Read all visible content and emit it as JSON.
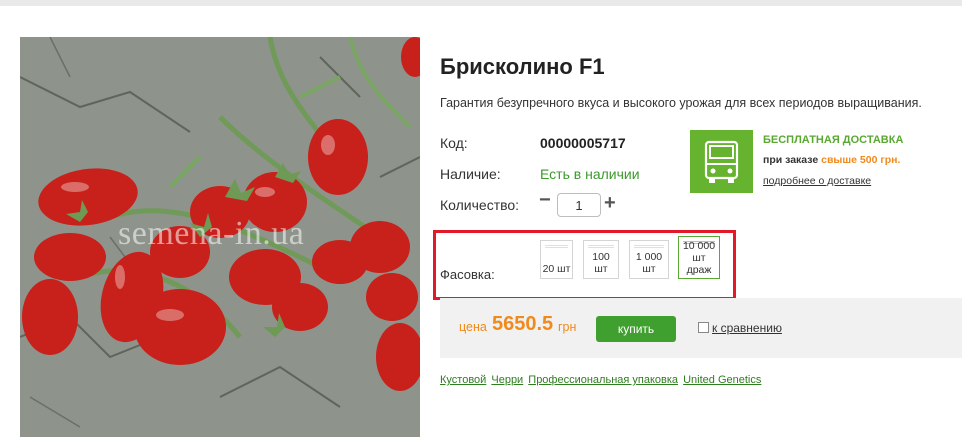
{
  "product": {
    "photo_alt": "Брисколино F1",
    "watermark": "semena-in.ua",
    "title": "Брисколино F1",
    "subtitle": "Гарантия безупречного вкуса и высокого урожая для всех периодов выращивания."
  },
  "details": {
    "code_label": "Код:",
    "code_value": "00000005717",
    "stock_label": "Наличие:",
    "stock_value": "Есть в наличии",
    "quantity_label": "Количество:",
    "quantity_value": "1",
    "minus_symbol": "−",
    "plus_symbol": "+"
  },
  "delivery": {
    "icon": "truck-icon",
    "title": "БЕСПЛАТНАЯ ДОСТАВКА",
    "condition_prefix": "при заказе",
    "condition_amount": "свыше 500 грн.",
    "link": "подробнее о доставке",
    "color": "#65b32e"
  },
  "packaging": {
    "label": "Фасовка:",
    "options": [
      {
        "label": "20 шт",
        "selected": false
      },
      {
        "label": "100 шт",
        "selected": false
      },
      {
        "label": "1 000 шт",
        "selected": false
      },
      {
        "label": "10 000 шт драж",
        "selected": true
      }
    ],
    "highlight_color": "#e3192a"
  },
  "purchase": {
    "price_label": "цена",
    "price_value": "5650.5",
    "currency": "грн",
    "buy_label": "купить",
    "compare_label": "к сравнению",
    "price_color": "#f08a1c",
    "buy_color": "#3f9f2f"
  },
  "tags": [
    "Кустовой",
    "Черри",
    "Профессиональная упаковка",
    "United Genetics"
  ]
}
